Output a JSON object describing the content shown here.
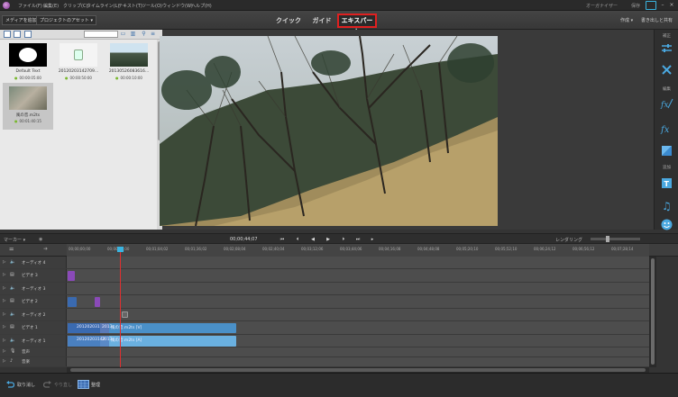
{
  "menu": {
    "items": [
      "ファイル(F)",
      "編集(E)",
      "クリップ(C)",
      "タイムライン(L)",
      "テキスト(T)",
      "ツール(O)",
      "ウィンドウ(W)",
      "ヘルプ(H)"
    ],
    "account": "オーガナイザー",
    "open_label": "保存"
  },
  "toolbar": {
    "add_media": "メディアを追加 ▾",
    "project_assets": "プロジェクトのアセット ▾",
    "tabs": [
      "クイック",
      "ガイド",
      "エキスパート"
    ],
    "active_tab": "エキスパート",
    "create": "作成 ▾",
    "share": "書き出しと共有"
  },
  "media": {
    "items": [
      {
        "name": "Default Text",
        "duration": "00:00:05:00"
      },
      {
        "name": "20120203142709...",
        "duration": "00:00:50:00"
      },
      {
        "name": "20130526083616...",
        "duration": "00:00:10:00"
      },
      {
        "name": "風の音.m2ts",
        "duration": "00:01:40:15"
      }
    ]
  },
  "right_panel": {
    "adjust": "補正",
    "edit": "編集",
    "add": "追加"
  },
  "timeline": {
    "marker": "マーカー ▾",
    "timecode": "00;00;44;07",
    "render": "レンダリング",
    "ruler": [
      "00;00;00;00",
      "00;00;32;00",
      "00;01;04;02",
      "00;01;36;02",
      "00;02;08;04",
      "00;02;40;04",
      "00;03;12;06",
      "00;03;44;06",
      "00;04;16;08",
      "00;04;48;08",
      "00;05;20;10",
      "00;05;52;10",
      "00;06;24;12",
      "00;06;56;12",
      "00;07;28;14"
    ],
    "tracks": [
      {
        "label": "オーディオ 4",
        "icon": "speaker"
      },
      {
        "label": "ビデオ 3",
        "icon": "film"
      },
      {
        "label": "オーディオ 3",
        "icon": "speaker"
      },
      {
        "label": "ビデオ 2",
        "icon": "film"
      },
      {
        "label": "オーディオ 2",
        "icon": "speaker"
      },
      {
        "label": "ビデオ 1",
        "icon": "film"
      },
      {
        "label": "オーディオ 1",
        "icon": "speaker"
      },
      {
        "label": "音声",
        "icon": "mic"
      },
      {
        "label": "音楽",
        "icon": "note"
      }
    ],
    "clips": {
      "video1_a": "201202031",
      "video1_b": "2013",
      "video1_c": "風の音.m2ts [V]",
      "audio1_a": "20120203142",
      "audio1_b": "2013",
      "audio1_c": "風の音.m2ts [A]"
    }
  },
  "bottom": {
    "undo": "取り消し",
    "redo": "やり直し",
    "organize": "整理"
  }
}
